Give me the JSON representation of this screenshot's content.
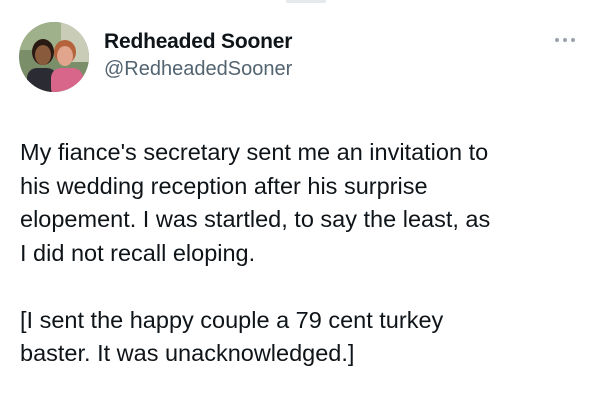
{
  "user": {
    "display_name": "Redheaded Sooner",
    "handle": "@RedheadedSooner"
  },
  "icons": {
    "avatar": "profile-photo",
    "more": "more-options-icon"
  },
  "colors": {
    "text": "#0f1419",
    "secondary_text": "#536471",
    "more_icon": "#9aa4ad"
  },
  "tweet": {
    "paragraphs": [
      "My fiance's secretary sent me an invitation to\nhis wedding reception after his surprise\nelopement.  I was startled, to say the least, as\nI did not recall eloping.",
      "[I sent the happy couple a 79 cent turkey\nbaster. It was unacknowledged.]"
    ]
  }
}
